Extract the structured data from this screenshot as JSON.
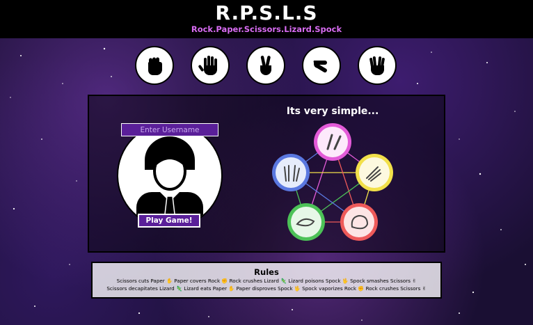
{
  "header": {
    "title": "R.P.S.L.S",
    "subtitle": "Rock.Paper.Scissors.Lizard.Spock"
  },
  "choices": [
    {
      "name": "rock",
      "icon": "fist-icon"
    },
    {
      "name": "paper",
      "icon": "open-hand-icon"
    },
    {
      "name": "scissors",
      "icon": "victory-hand-icon"
    },
    {
      "name": "lizard",
      "icon": "lizard-hand-icon"
    },
    {
      "name": "spock",
      "icon": "vulcan-salute-icon"
    }
  ],
  "player": {
    "username_placeholder": "Enter Username",
    "play_label": "Play Game!"
  },
  "diagram": {
    "heading": "Its very simple...",
    "nodes": [
      {
        "name": "scissors",
        "color": "#e35bd8"
      },
      {
        "name": "paper",
        "color": "#f2e04a"
      },
      {
        "name": "rock",
        "color": "#ee5a5a"
      },
      {
        "name": "lizard",
        "color": "#4cc257"
      },
      {
        "name": "spock",
        "color": "#5a78e0"
      }
    ]
  },
  "rules": {
    "title": "Rules",
    "line1": "Scissors cuts Paper ✋ Paper covers Rock ✊ Rock crushes Lizard 🦎 Lizard poisons Spock 🖖 Spock smashes Scissors ✌",
    "line2": "Scissors decapitates Lizard 🦎 Lizard eats Paper ✋ Paper disproves Spock 🖖 Spock vaporizes Rock ✊ Rock crushes Scissors ✌"
  },
  "colors": {
    "header_bg": "#000000",
    "subtitle": "#d86cf2",
    "button_bg": "#5a1f99"
  }
}
